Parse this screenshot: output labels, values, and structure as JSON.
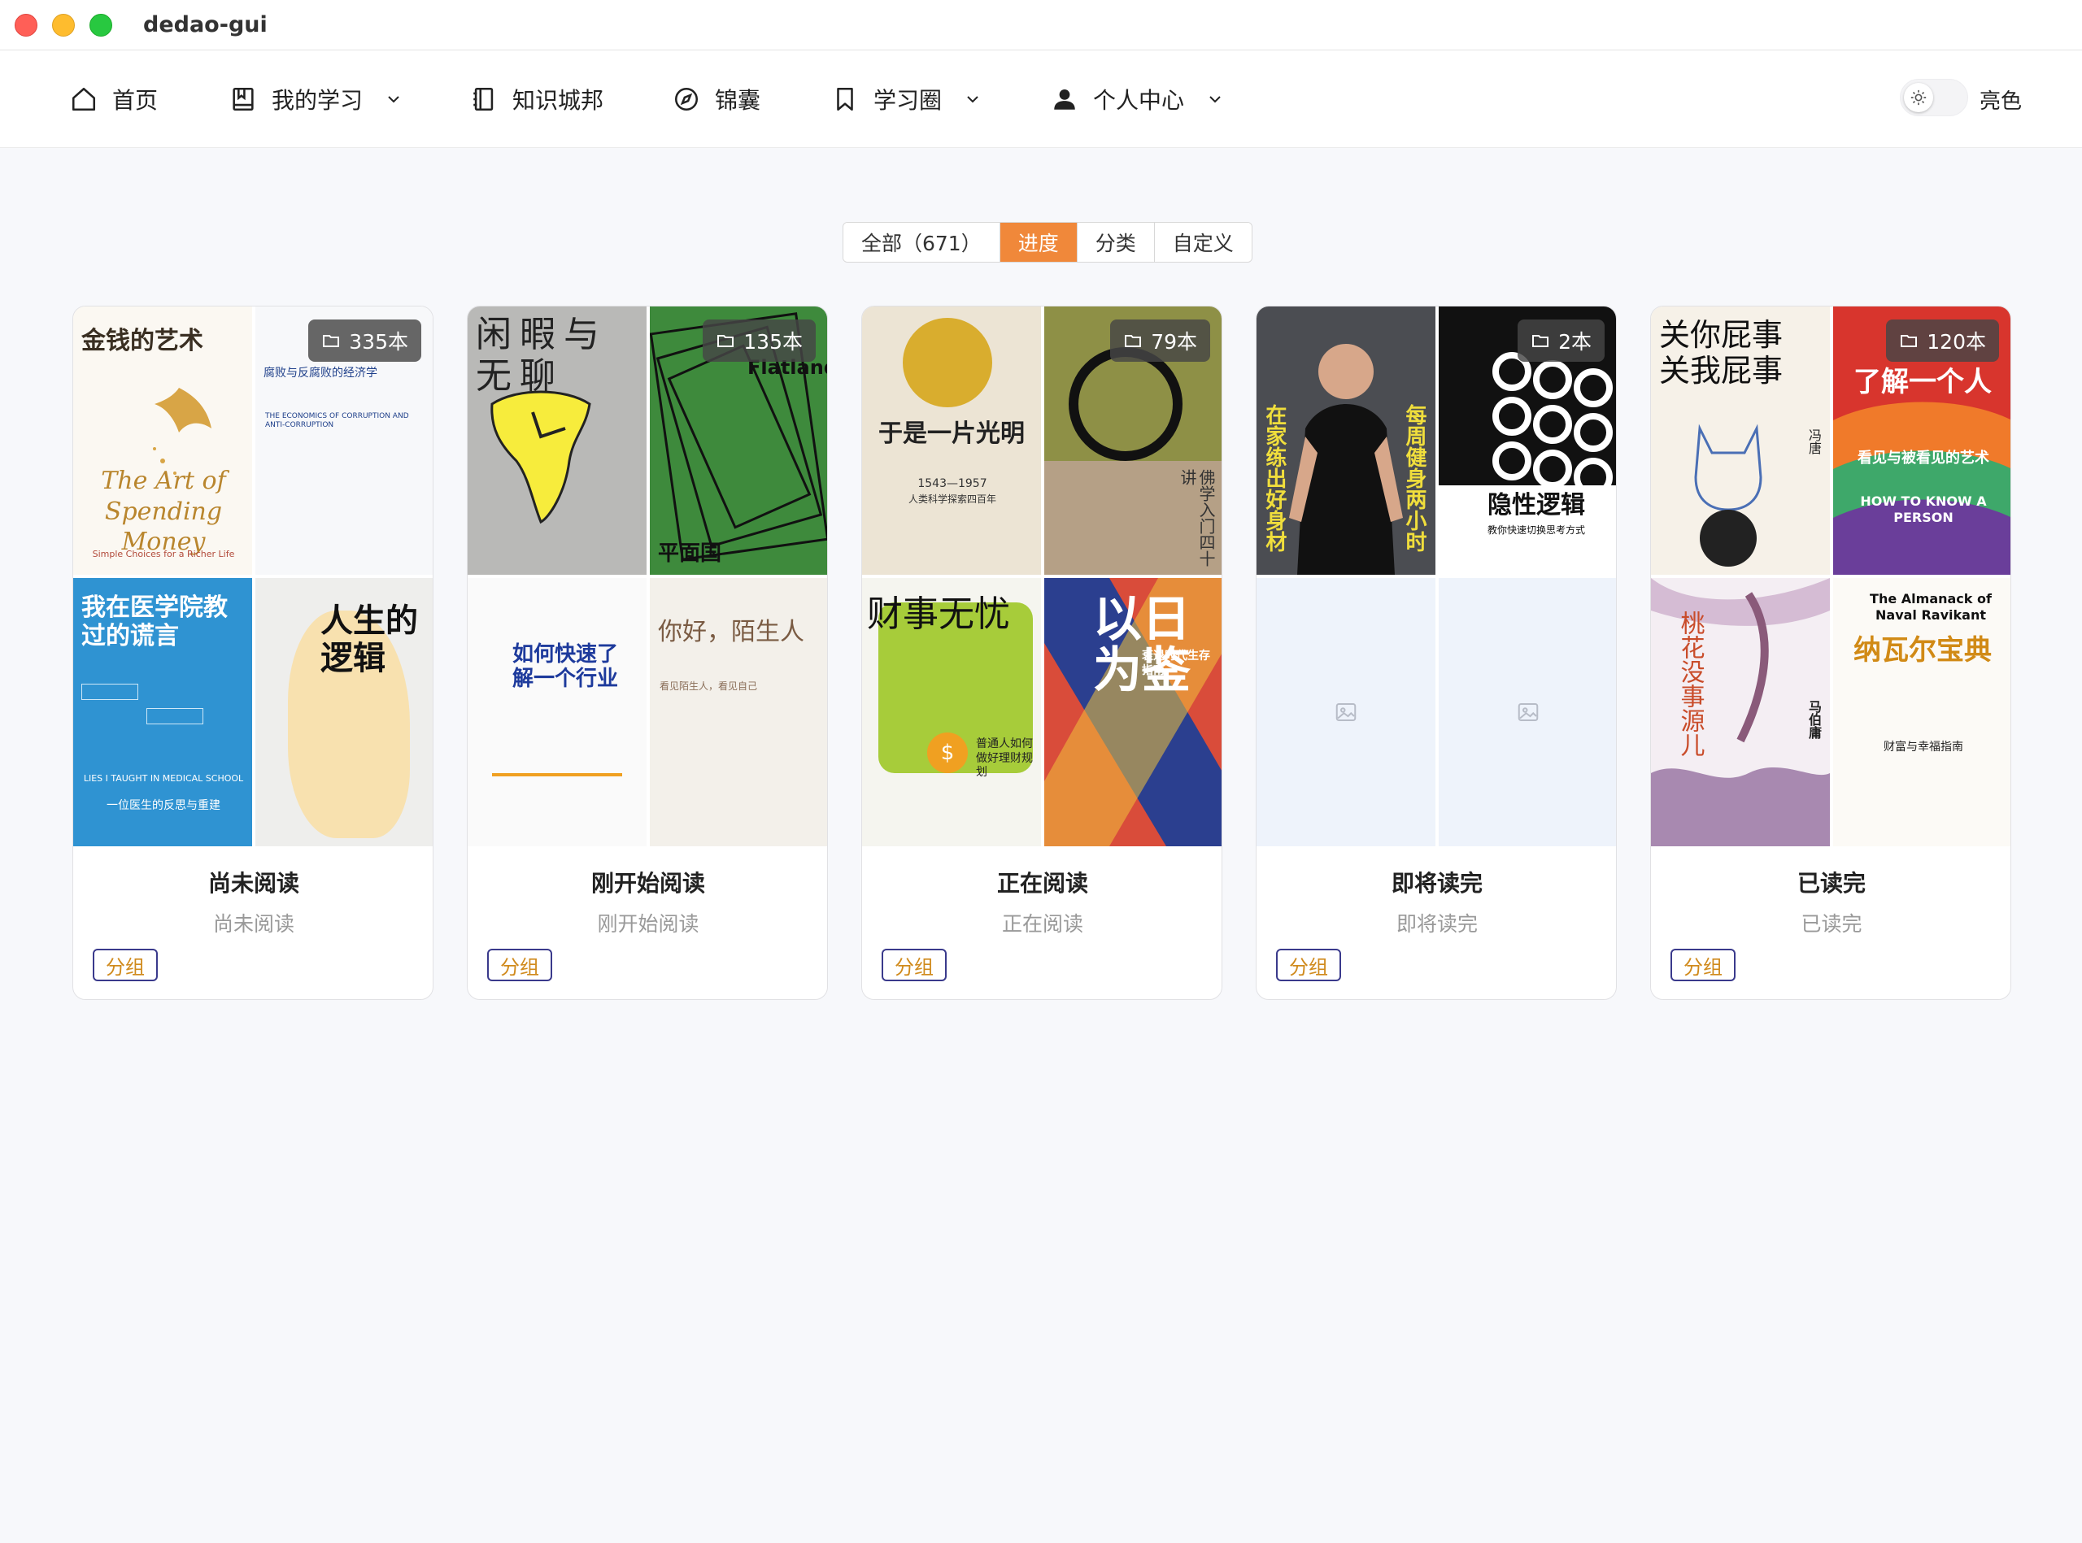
{
  "window": {
    "title": "dedao-gui"
  },
  "nav": {
    "home": "首页",
    "my_study": "我的学习",
    "knowledge_city": "知识城邦",
    "jinnang": "锦囊",
    "study_circle": "学习圈",
    "personal_center": "个人中心"
  },
  "theme": {
    "label": "亮色"
  },
  "tabs": [
    "全部（671）",
    "进度",
    "分类",
    "自定义"
  ],
  "cards": [
    {
      "title": "尚未阅读",
      "subtitle": "尚未阅读",
      "count": "335本",
      "group_label": "分组",
      "covers": [
        {
          "title": "金钱的艺术",
          "sub": "The Art of Spending Money",
          "sub2": "Simple Choices for a Richer Life"
        },
        {
          "title": "腐败与反腐败的经济学",
          "sub": "THE ECONOMICS OF CORRUPTION AND ANTI-CORRUPTION"
        },
        {
          "title": "我在医学院教过的谎言",
          "sub": "LIES I TAUGHT IN MEDICAL SCHOOL",
          "sub2": "一位医生的反思与重建"
        },
        {
          "title": "人生的逻辑",
          "sub": ""
        }
      ]
    },
    {
      "title": "刚开始阅读",
      "subtitle": "刚开始阅读",
      "count": "135本",
      "group_label": "分组",
      "covers": [
        {
          "title": "闲暇与无聊",
          "sub": ""
        },
        {
          "title": "平面国",
          "sub": "Flatland"
        },
        {
          "title": "如何快速了解一个行业",
          "sub": ""
        },
        {
          "title": "你好，陌生人",
          "sub": "看见陌生人，看见自己"
        }
      ]
    },
    {
      "title": "正在阅读",
      "subtitle": "正在阅读",
      "count": "79本",
      "group_label": "分组",
      "covers": [
        {
          "title": "于是一片光明",
          "sub": "1543—1957",
          "sub2": "人类科学探索四百年"
        },
        {
          "title": "佛学入门四十讲",
          "sub": ""
        },
        {
          "title": "财事无忧",
          "sub": "普通人如何做好理财规划"
        },
        {
          "title": "以日为鉴",
          "sub": "衰退时代生存指南"
        }
      ]
    },
    {
      "title": "即将读完",
      "subtitle": "即将读完",
      "count": "2本",
      "group_label": "分组",
      "covers": [
        {
          "title": "在家练出好身材",
          "sub": "每周健身两小时"
        },
        {
          "title": "隐性逻辑",
          "sub": "教你快速切换思考方式"
        },
        {
          "title": "",
          "sub": ""
        },
        {
          "title": "",
          "sub": ""
        }
      ]
    },
    {
      "title": "已读完",
      "subtitle": "已读完",
      "count": "120本",
      "group_label": "分组",
      "covers": [
        {
          "title": "关你屁事 关我屁事",
          "sub": "冯唐"
        },
        {
          "title": "了解一个人",
          "sub": "看见与被看见的艺术",
          "sub2": "HOW TO KNOW A PERSON"
        },
        {
          "title": "桃花没事源儿",
          "sub": "马伯庸"
        },
        {
          "title": "纳瓦尔宝典",
          "sub": "The Almanack of Naval Ravikant",
          "sub2": "财富与幸福指南"
        }
      ]
    }
  ]
}
